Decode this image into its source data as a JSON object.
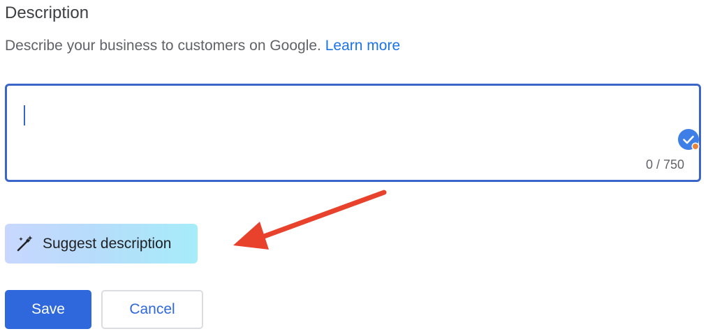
{
  "section": {
    "title": "Description",
    "help_text": "Describe your business to customers on Google.",
    "help_link": "Learn more"
  },
  "description_field": {
    "value": "",
    "char_count": "0 / 750",
    "current_length": 0,
    "max_length": 750,
    "focused": true,
    "accent_color": "#3b66c9",
    "badge_icon": "grammar-check-icon"
  },
  "suggest_button": {
    "label": "Suggest description",
    "icon": "magic-wand-icon"
  },
  "annotation": {
    "icon": "red-arrow-icon",
    "color": "#e8412c"
  },
  "actions": {
    "save_label": "Save",
    "cancel_label": "Cancel",
    "primary_color": "#2f68dc"
  }
}
